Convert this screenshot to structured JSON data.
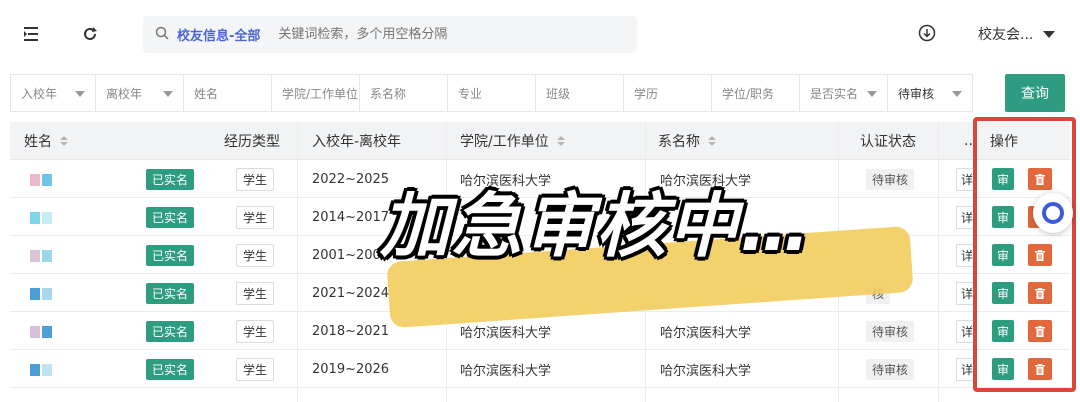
{
  "search": {
    "scope": "校友信息-全部",
    "placeholder": "关键词检索，多个用空格分隔"
  },
  "user": {
    "name": "校友会..."
  },
  "filters": [
    {
      "label": "入校年",
      "dropdown": true,
      "w": 86
    },
    {
      "label": "离校年",
      "dropdown": true,
      "w": 89
    },
    {
      "label": "姓名",
      "dropdown": false,
      "w": 89
    },
    {
      "label": "学院/工作单位",
      "dropdown": false,
      "w": 89
    },
    {
      "label": "系名称",
      "dropdown": false,
      "w": 89
    },
    {
      "label": "专业",
      "dropdown": false,
      "w": 89
    },
    {
      "label": "班级",
      "dropdown": false,
      "w": 89
    },
    {
      "label": "学历",
      "dropdown": false,
      "w": 89
    },
    {
      "label": "学位/职务",
      "dropdown": false,
      "w": 89
    },
    {
      "label": "是否实名",
      "dropdown": true,
      "w": 89
    },
    {
      "label": "待审核",
      "dropdown": true,
      "w": 86
    }
  ],
  "query_label": "查询",
  "columns": {
    "name": "姓名",
    "exp_type": "经历类型",
    "years": "入校年-离校年",
    "college": "学院/工作单位",
    "dept": "系名称",
    "status": "认证状态",
    "more": "..",
    "actions": "操作"
  },
  "rows": [
    {
      "verified": "已实名",
      "type": "学生",
      "years": "2022~2025",
      "college": "哈尔滨医科大学",
      "dept": "哈尔滨医科大学",
      "status": "待审核",
      "detail": "详",
      "audit": "审"
    },
    {
      "verified": "已实名",
      "type": "学生",
      "years": "2014~2017",
      "college": "",
      "dept": "",
      "status": "",
      "detail": "详",
      "audit": "审"
    },
    {
      "verified": "已实名",
      "type": "学生",
      "years": "2001~2003",
      "college": "",
      "dept": "",
      "status": "",
      "detail": "详",
      "audit": "审"
    },
    {
      "verified": "已实名",
      "type": "学生",
      "years": "2021~2024",
      "college": "",
      "dept": "",
      "status": "核",
      "detail": "详",
      "audit": "审"
    },
    {
      "verified": "已实名",
      "type": "学生",
      "years": "2018~2021",
      "college": "哈尔滨医科大学",
      "dept": "哈尔滨医科大学",
      "status": "待审核",
      "detail": "详",
      "audit": "审"
    },
    {
      "verified": "已实名",
      "type": "学生",
      "years": "2019~2026",
      "college": "哈尔滨医科大学",
      "dept": "哈尔滨医科大学",
      "status": "待审核",
      "detail": "详",
      "audit": "审"
    }
  ],
  "caption": "加急审核中…",
  "colors": {
    "primary": "#2e9c80",
    "danger": "#e0683a",
    "highlight": "#d9473a",
    "accent_blue": "#4a64d8"
  }
}
